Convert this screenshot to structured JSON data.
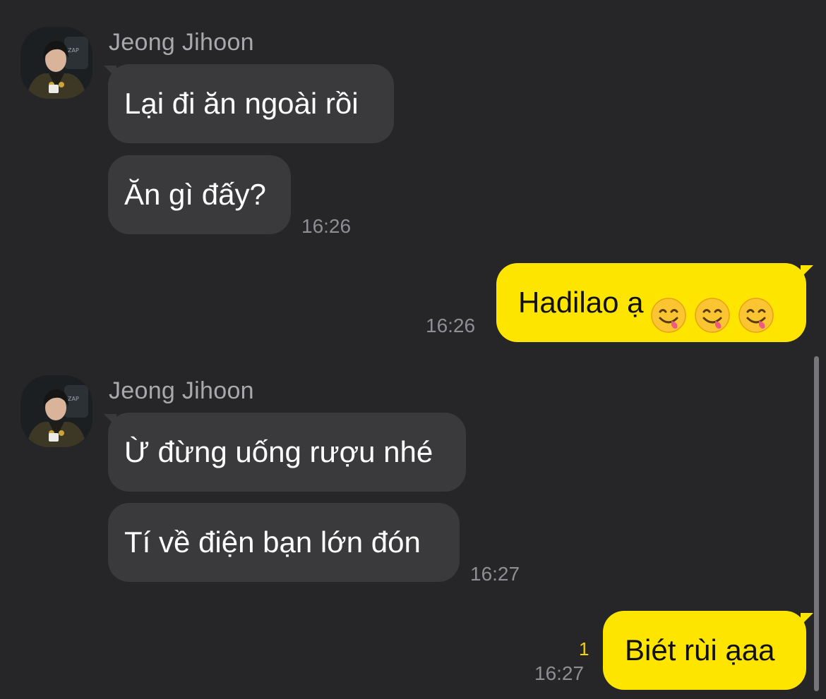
{
  "groups": [
    {
      "sender_name": "Jeong Jihoon",
      "messages": [
        "Lại đi ăn ngoài rồi",
        "Ăn gì đấy?"
      ],
      "time": "16:26"
    },
    {
      "sender_name": "Jeong Jihoon",
      "messages": [
        "Ừ đừng uống rượu nhé",
        "Tí về điện bạn lớn đón"
      ],
      "time": "16:27"
    }
  ],
  "outgoing": [
    {
      "text": "Hadilao ạ",
      "emojis": [
        "yum-face-emoji",
        "yum-face-emoji",
        "yum-face-emoji"
      ],
      "time": "16:26"
    },
    {
      "text": "Biét rùi ạaa",
      "unread_count": "1",
      "time": "16:27"
    }
  ],
  "colors": {
    "background": "#262628",
    "incoming_bubble": "#3a3a3d",
    "outgoing_bubble": "#fee500",
    "timestamp": "#8e8e93",
    "sender_name": "#a9a9ad",
    "unread_count": "#f2d600"
  }
}
